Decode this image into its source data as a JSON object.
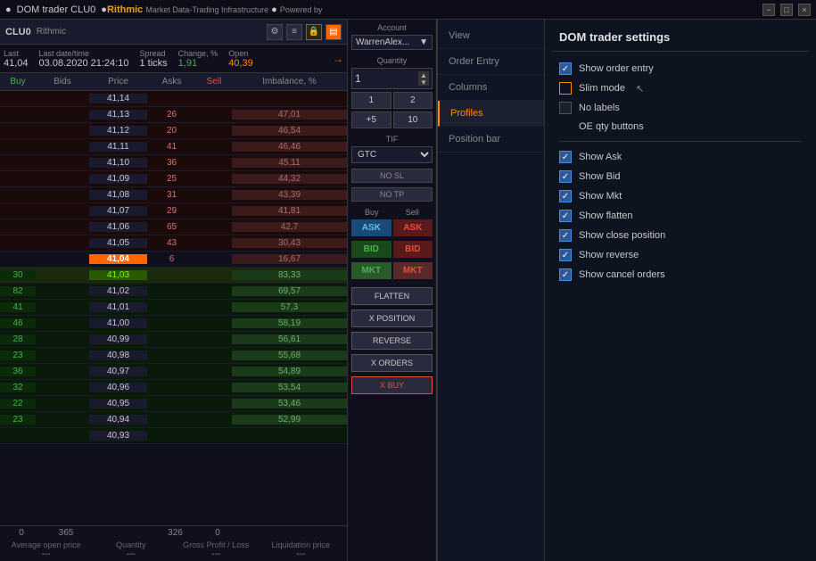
{
  "titlebar": {
    "title": "DOM trader CLU0",
    "brand": "Rithmic",
    "subtitle": "Market Data-Trading Infrastructure",
    "powered": "Powered by"
  },
  "dom": {
    "symbol": "CLU0",
    "broker": "Rithmic",
    "stats": {
      "last_label": "Last",
      "last_value": "41,04",
      "date_label": "Last date/time",
      "date_value": "03.08.2020 21:24:10",
      "spread_label": "Spread",
      "spread_value": "1 ticks",
      "change_label": "Change, %",
      "change_value": "1,91",
      "open_label": "Open",
      "open_value": "40,39"
    },
    "columns": [
      "Buy",
      "Bids",
      "Price",
      "Asks",
      "Sell",
      "Imbalance, %"
    ],
    "rows": [
      {
        "buy": "",
        "bids": "",
        "price": "41,14",
        "asks": "",
        "sell": "",
        "imbalance": "",
        "type": "ask"
      },
      {
        "buy": "",
        "bids": "",
        "price": "41,13",
        "asks": "26",
        "sell": "",
        "imbalance": "47,01",
        "type": "ask"
      },
      {
        "buy": "",
        "bids": "",
        "price": "41,12",
        "asks": "20",
        "sell": "",
        "imbalance": "46,54",
        "type": "ask"
      },
      {
        "buy": "",
        "bids": "",
        "price": "41,11",
        "asks": "41",
        "sell": "",
        "imbalance": "46,46",
        "type": "ask"
      },
      {
        "buy": "",
        "bids": "",
        "price": "41,10",
        "asks": "36",
        "sell": "",
        "imbalance": "45,11",
        "type": "ask"
      },
      {
        "buy": "",
        "bids": "",
        "price": "41,09",
        "asks": "25",
        "sell": "",
        "imbalance": "44,32",
        "type": "ask"
      },
      {
        "buy": "",
        "bids": "",
        "price": "41,08",
        "asks": "31",
        "sell": "",
        "imbalance": "43,39",
        "type": "ask"
      },
      {
        "buy": "",
        "bids": "",
        "price": "41,07",
        "asks": "29",
        "sell": "",
        "imbalance": "41,81",
        "type": "ask"
      },
      {
        "buy": "",
        "bids": "",
        "price": "41,06",
        "asks": "65",
        "sell": "",
        "imbalance": "42,7",
        "type": "ask"
      },
      {
        "buy": "",
        "bids": "",
        "price": "41,05",
        "asks": "43",
        "sell": "",
        "imbalance": "30,43",
        "type": "ask"
      },
      {
        "buy": "",
        "bids": "",
        "price": "41,04",
        "asks": "6",
        "sell": "",
        "imbalance": "16,67",
        "type": "current"
      },
      {
        "buy": "30",
        "bids": "",
        "price": "41,03",
        "asks": "",
        "sell": "",
        "imbalance": "83,33",
        "type": "bid-current"
      },
      {
        "buy": "82",
        "bids": "",
        "price": "41,02",
        "asks": "",
        "sell": "",
        "imbalance": "69,57",
        "type": "bid"
      },
      {
        "buy": "41",
        "bids": "",
        "price": "41,01",
        "asks": "",
        "sell": "",
        "imbalance": "57,3",
        "type": "bid"
      },
      {
        "buy": "46",
        "bids": "",
        "price": "41,00",
        "asks": "",
        "sell": "",
        "imbalance": "58,19",
        "type": "bid"
      },
      {
        "buy": "28",
        "bids": "",
        "price": "40,99",
        "asks": "",
        "sell": "",
        "imbalance": "56,61",
        "type": "bid"
      },
      {
        "buy": "23",
        "bids": "",
        "price": "40,98",
        "asks": "",
        "sell": "",
        "imbalance": "55,68",
        "type": "bid"
      },
      {
        "buy": "36",
        "bids": "",
        "price": "40,97",
        "asks": "",
        "sell": "",
        "imbalance": "54,89",
        "type": "bid"
      },
      {
        "buy": "32",
        "bids": "",
        "price": "40,96",
        "asks": "",
        "sell": "",
        "imbalance": "53,54",
        "type": "bid"
      },
      {
        "buy": "22",
        "bids": "",
        "price": "40,95",
        "asks": "",
        "sell": "",
        "imbalance": "53,46",
        "type": "bid"
      },
      {
        "buy": "23",
        "bids": "",
        "price": "40,94",
        "asks": "",
        "sell": "",
        "imbalance": "52,99",
        "type": "bid"
      },
      {
        "buy": "",
        "bids": "",
        "price": "40,93",
        "asks": "",
        "sell": "",
        "imbalance": "",
        "type": "bid"
      }
    ],
    "footer": {
      "buy_total": "0",
      "qty_total": "365",
      "price_empty": "",
      "asks_total": "326",
      "sell_total": "0",
      "labels": [
        "Average open price",
        "Quantity",
        "Gross Profit / Loss",
        "Liquidation price"
      ],
      "values": [
        "---",
        "---",
        "---",
        "---"
      ]
    }
  },
  "order_entry": {
    "account_label": "Account",
    "account_name": "WarrenAlex...",
    "quantity_label": "Quantity",
    "quantity_value": "1",
    "qty_buttons": [
      "1",
      "2",
      "+5",
      "10"
    ],
    "tif_label": "TIF",
    "tif_value": "GTC",
    "sl_btn": "NO SL",
    "tp_btn": "NO TP",
    "buy_label": "Buy",
    "sell_label": "Sell",
    "ask_btn": "ASK",
    "bid_btn": "BID",
    "mkt_btn": "MKT",
    "flatten_btn": "FLATTEN",
    "x_position_btn": "X POSITION",
    "reverse_btn": "REVERSE",
    "x_orders_btn": "X ORDERS",
    "x_buy_btn": "X BUY"
  },
  "settings": {
    "title": "DOM trader settings",
    "nav_items": [
      "View",
      "Order Entry",
      "Columns",
      "Profiles",
      "Position bar"
    ],
    "active_nav": "View",
    "options": [
      {
        "label": "Show order entry",
        "checked": true,
        "id": "show_order_entry"
      },
      {
        "label": "Slim mode",
        "checked": false,
        "id": "slim_mode",
        "orange": true
      },
      {
        "label": "No labels",
        "checked": false,
        "id": "no_labels"
      },
      {
        "label": "OE qty buttons",
        "checked": false,
        "id": "oe_qty",
        "header": true
      },
      {
        "label": "Show Ask",
        "checked": true,
        "id": "show_ask"
      },
      {
        "label": "Show Bid",
        "checked": true,
        "id": "show_bid"
      },
      {
        "label": "Show Mkt",
        "checked": true,
        "id": "show_mkt"
      },
      {
        "label": "Show flatten",
        "checked": true,
        "id": "show_flatten"
      },
      {
        "label": "Show close position",
        "checked": true,
        "id": "show_close_position"
      },
      {
        "label": "Show reverse",
        "checked": true,
        "id": "show_reverse"
      },
      {
        "label": "Show cancel orders",
        "checked": true,
        "id": "show_cancel_orders"
      }
    ]
  }
}
